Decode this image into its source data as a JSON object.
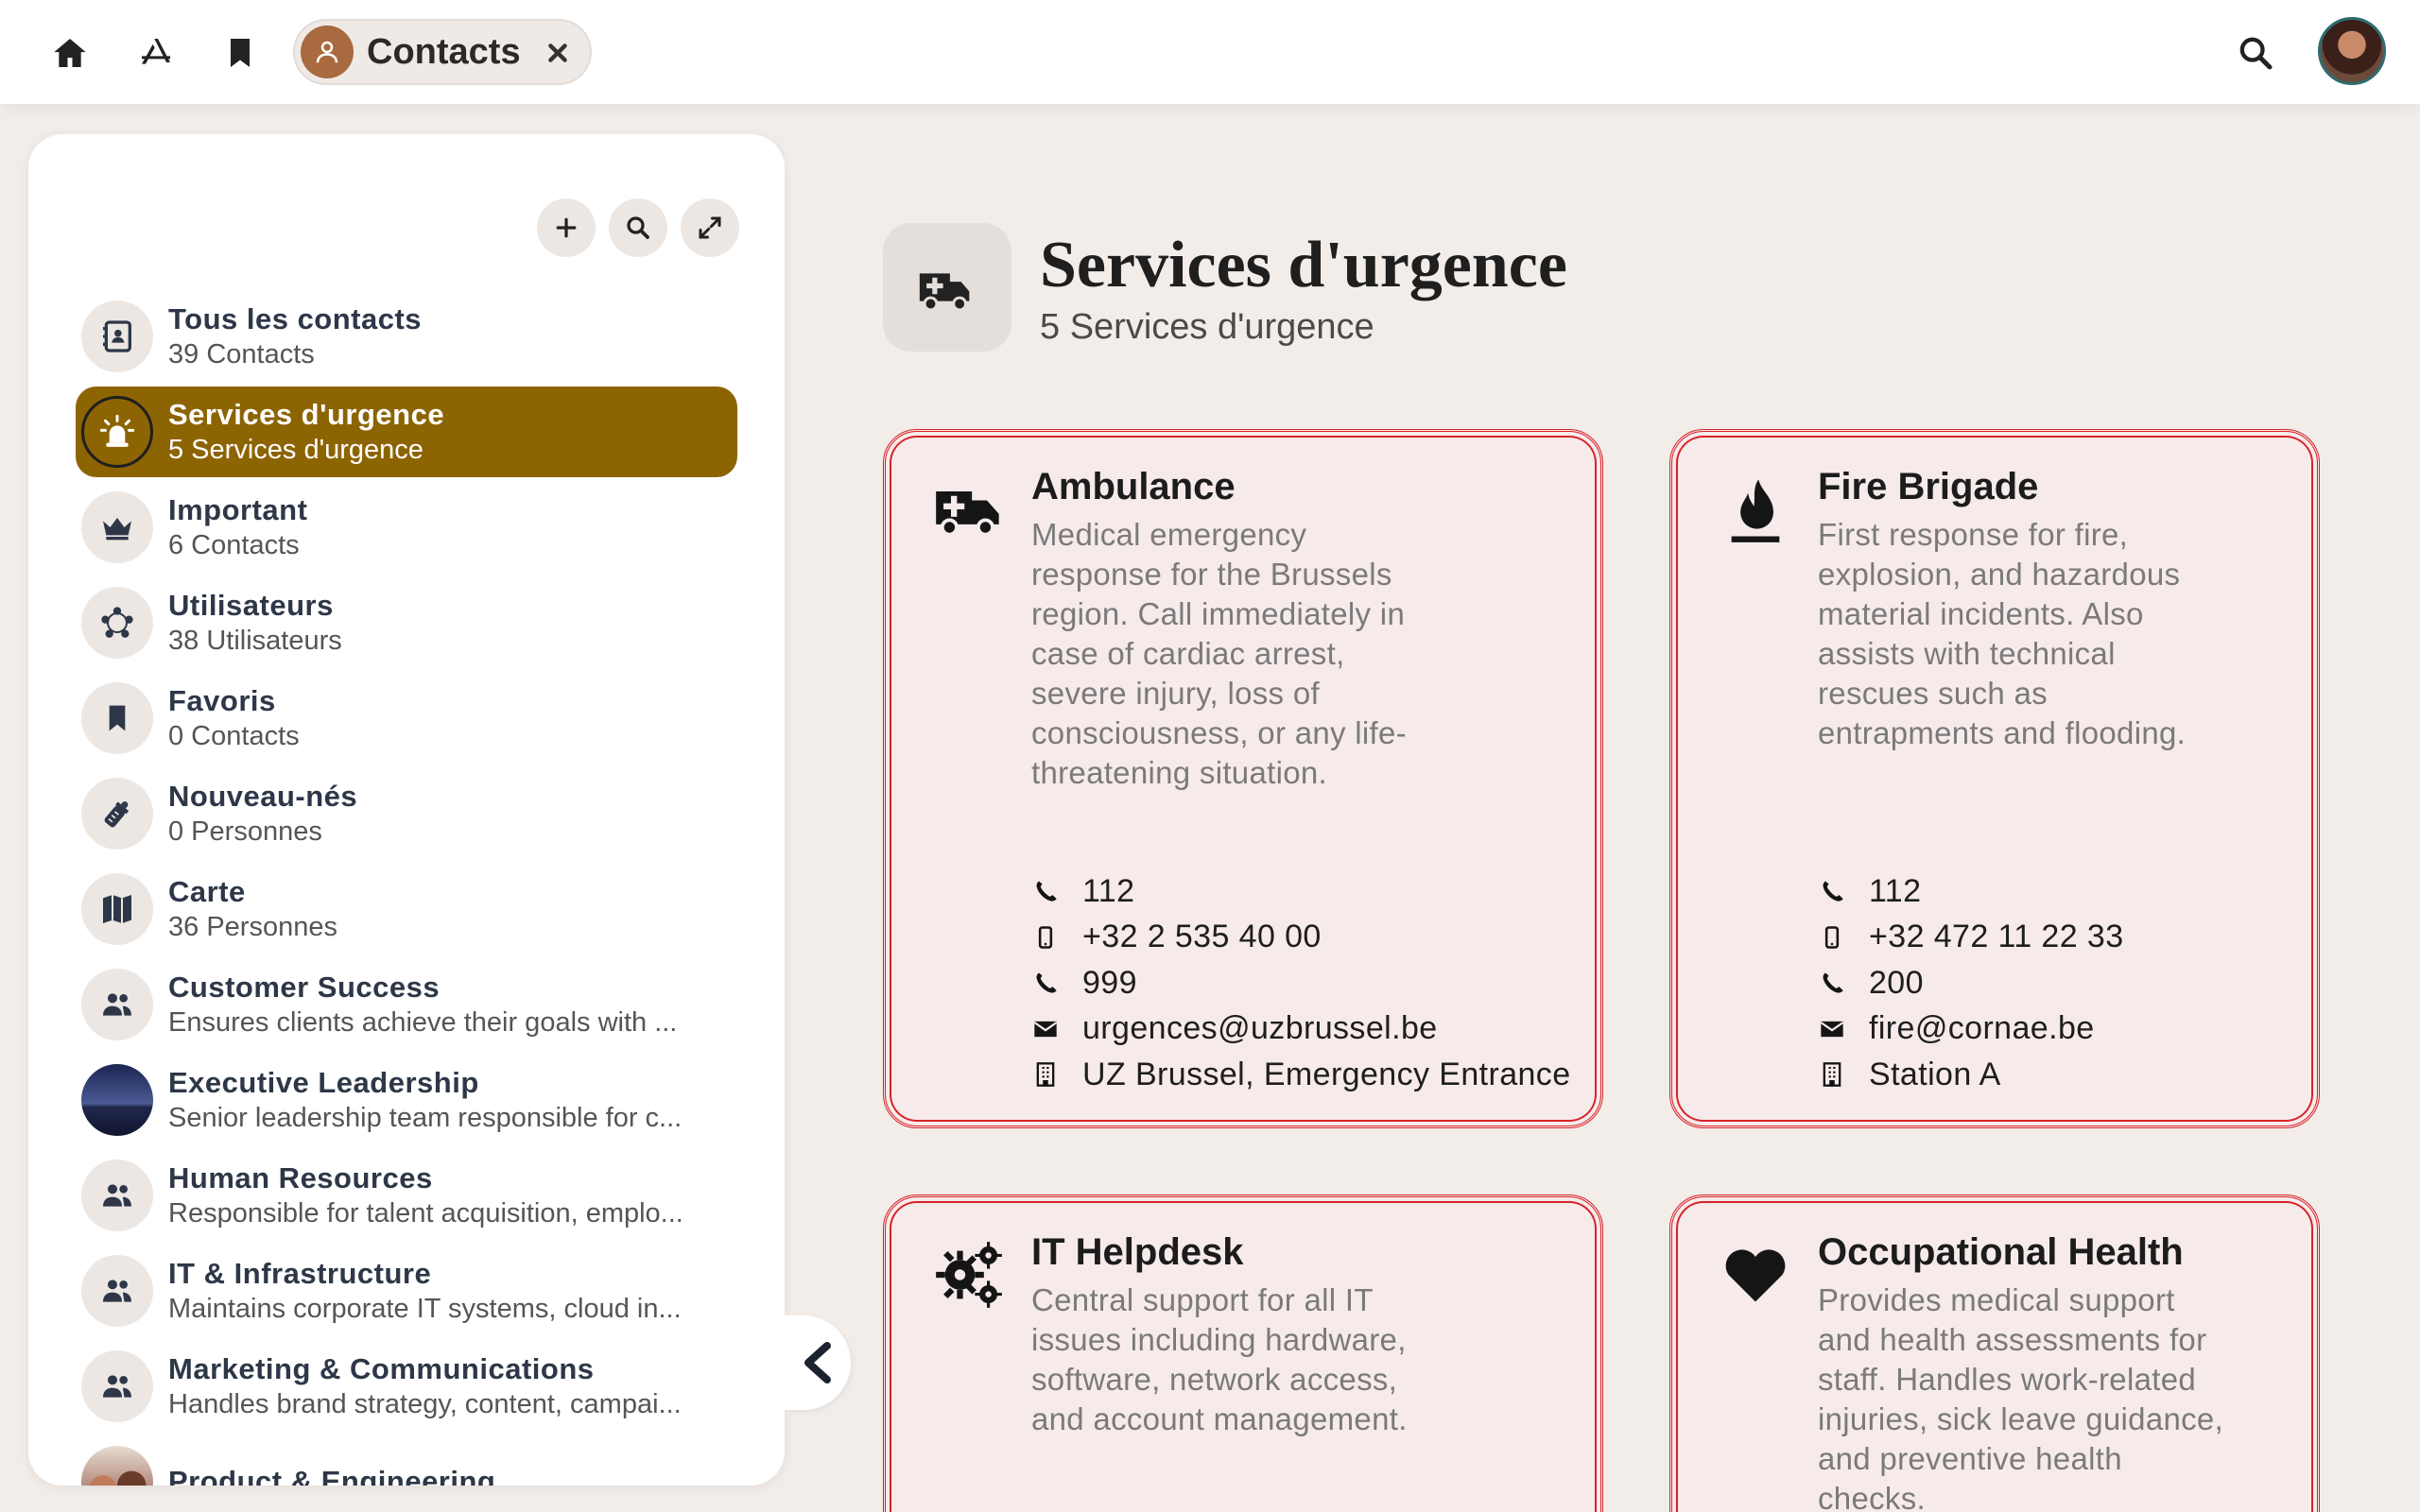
{
  "topbar": {
    "icons": [
      "home-icon",
      "app-store-icon",
      "bookmark-icon"
    ],
    "tab_label": "Contacts",
    "search_icon": "search-icon"
  },
  "sidebar": {
    "tools": [
      "plus-icon",
      "search-icon",
      "expand-icon"
    ],
    "items": [
      {
        "title": "Tous les contacts",
        "subtitle": "39 Contacts",
        "icon": "address-book-icon"
      },
      {
        "title": "Services d'urgence",
        "subtitle": "5 Services d'urgence",
        "icon": "siren-icon",
        "active": true
      },
      {
        "title": "Important",
        "subtitle": "6 Contacts",
        "icon": "crown-icon"
      },
      {
        "title": "Utilisateurs",
        "subtitle": "38 Utilisateurs",
        "icon": "users-circle-icon"
      },
      {
        "title": "Favoris",
        "subtitle": "0 Contacts",
        "icon": "bookmark-icon"
      },
      {
        "title": "Nouveau-nés",
        "subtitle": "0 Personnes",
        "icon": "baby-bottle-icon"
      },
      {
        "title": "Carte",
        "subtitle": "36 Personnes",
        "icon": "map-icon"
      },
      {
        "title": "Customer Success",
        "subtitle": "Ensures clients achieve their goals with ...",
        "icon": "group-icon"
      },
      {
        "title": "Executive Leadership",
        "subtitle": "Senior leadership team responsible for c...",
        "icon": "night-photo"
      },
      {
        "title": "Human Resources",
        "subtitle": "Responsible for talent acquisition, emplo...",
        "icon": "group-icon"
      },
      {
        "title": "IT & Infrastructure",
        "subtitle": "Maintains corporate IT systems, cloud in...",
        "icon": "group-icon"
      },
      {
        "title": "Marketing & Communications",
        "subtitle": "Handles brand strategy, content, campai...",
        "icon": "group-icon"
      },
      {
        "title": "Product & Engineering",
        "subtitle": "",
        "icon": "team-photo"
      }
    ]
  },
  "page": {
    "title": "Services d'urgence",
    "subtitle": "5 Services d'urgence"
  },
  "cards": [
    {
      "title": "Ambulance",
      "icon": "ambulance-icon",
      "description": "Medical emergency response for the Brussels region. Call immediately in case of cardiac arrest, severe injury, loss of consciousness, or any life-threatening situation.",
      "contacts": [
        {
          "type": "phone",
          "value": "112"
        },
        {
          "type": "mobile",
          "value": "+32 2 535 40 00"
        },
        {
          "type": "phone",
          "value": "999"
        },
        {
          "type": "email",
          "value": "urgences@uzbrussel.be"
        },
        {
          "type": "building",
          "value": "UZ Brussel, Emergency Entrance"
        }
      ]
    },
    {
      "title": "Fire Brigade",
      "icon": "fire-icon",
      "description": "First response for fire, explosion, and hazardous material incidents. Also assists with technical rescues such as entrapments and flooding.",
      "contacts": [
        {
          "type": "phone",
          "value": "112"
        },
        {
          "type": "mobile",
          "value": "+32 472 11 22 33"
        },
        {
          "type": "phone",
          "value": "200"
        },
        {
          "type": "email",
          "value": "fire@cornae.be"
        },
        {
          "type": "building",
          "value": "Station A"
        }
      ]
    },
    {
      "title": "IT Helpdesk",
      "icon": "gears-icon",
      "description": "Central support for all IT issues including hardware, software, network access, and account management.",
      "contacts": []
    },
    {
      "title": "Occupational Health",
      "icon": "heart-icon",
      "description": "Provides medical support and health assessments for staff. Handles work-related injuries, sick leave guidance, and preventive health checks.",
      "contacts": []
    }
  ]
}
